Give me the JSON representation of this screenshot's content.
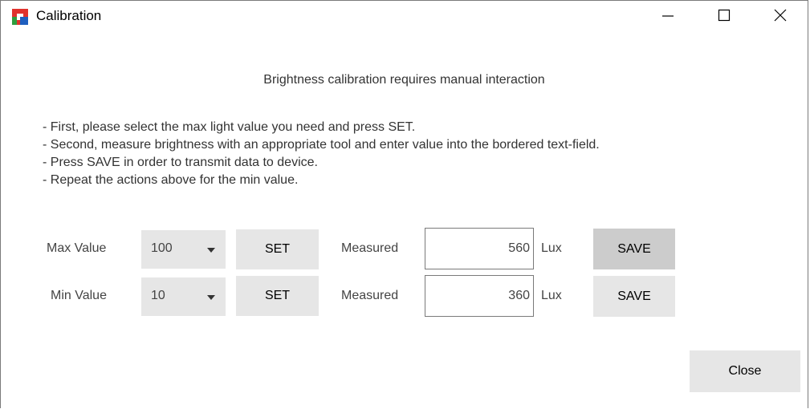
{
  "window": {
    "title": "Calibration",
    "minimize_icon": "minimize-icon",
    "maximize_icon": "maximize-icon",
    "close_icon": "close-icon"
  },
  "heading": "Brightness calibration requires manual interaction",
  "instructions": [
    "- First, please select the max light value you need and press SET.",
    "- Second, measure brightness with an appropriate tool and enter value into the bordered text-field.",
    "- Press SAVE in order to transmit data to device.",
    "- Repeat the actions above for the min value."
  ],
  "max_row": {
    "label": "Max Value",
    "selected": "100",
    "set_label": "SET",
    "measured_label": "Measured",
    "measured_value": "560",
    "unit": "Lux",
    "save_label": "SAVE"
  },
  "min_row": {
    "label": "Min Value",
    "selected": "10",
    "set_label": "SET",
    "measured_label": "Measured",
    "measured_value": "360",
    "unit": "Lux",
    "save_label": "SAVE"
  },
  "close_label": "Close",
  "colors": {
    "button_bg": "#e6e6e6",
    "button_pressed_bg": "#cccccc",
    "icon_red": "#e0322d",
    "icon_blue": "#1f5fbf",
    "icon_green": "#2e9e3e"
  }
}
